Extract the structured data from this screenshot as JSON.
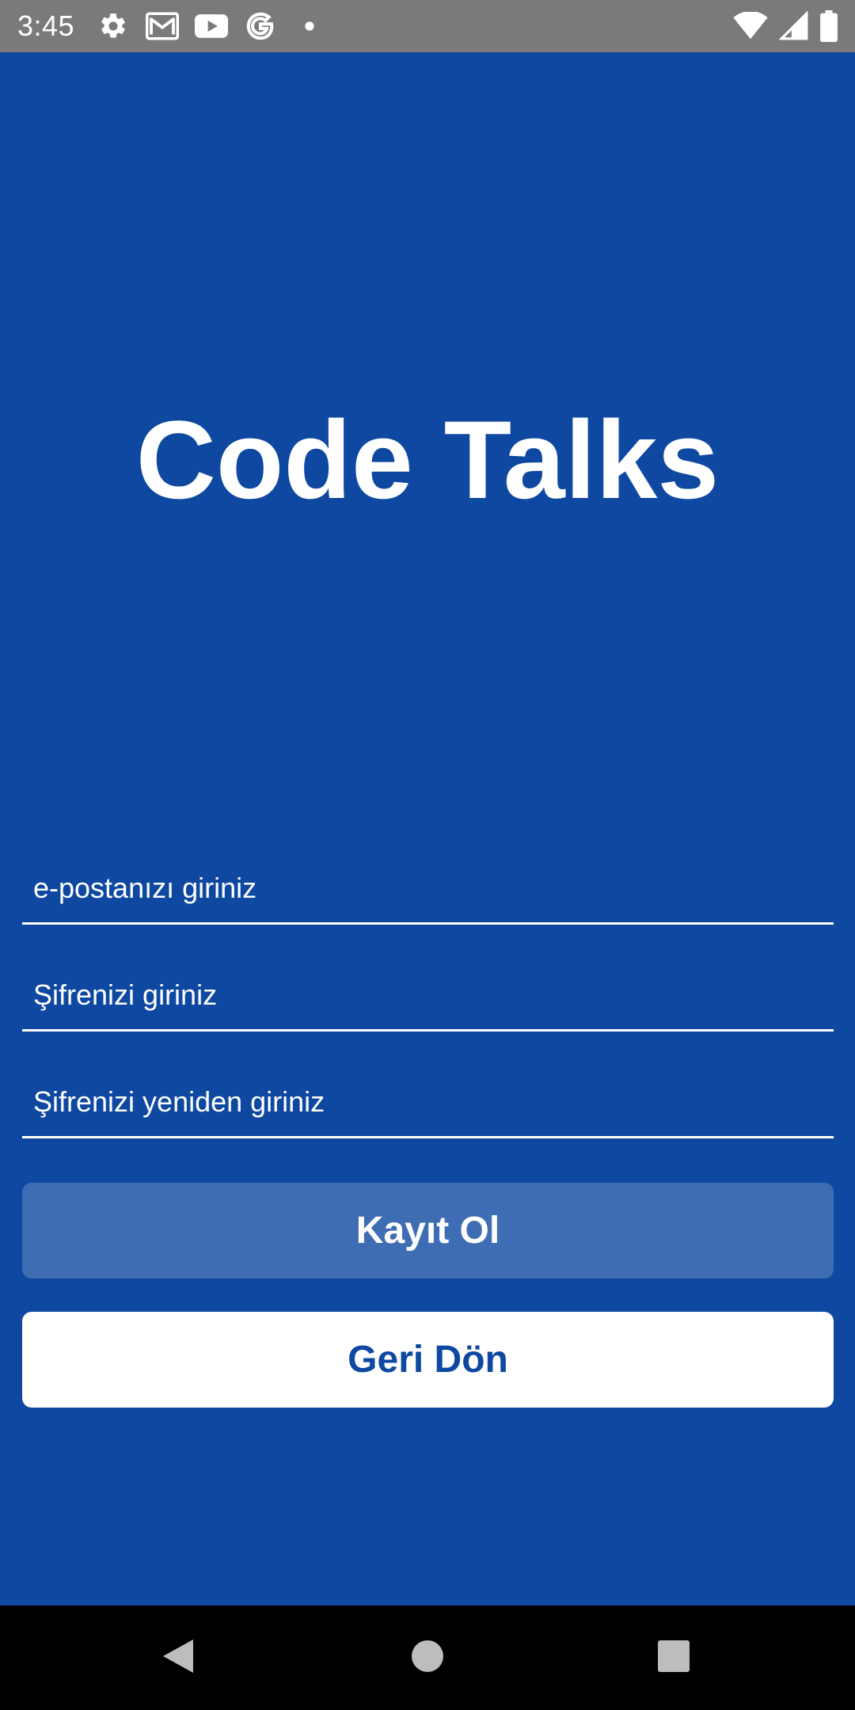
{
  "status_bar": {
    "time": "3:45",
    "left_icons": [
      "settings-icon",
      "gmail-icon",
      "youtube-icon",
      "google-icon",
      "notification-dot-icon"
    ],
    "right_icons": [
      "wifi-icon",
      "signal-icon",
      "battery-icon"
    ]
  },
  "app": {
    "title": "Code Talks"
  },
  "form": {
    "email_placeholder": "e-postanızı giriniz",
    "password_placeholder": "Şifrenizi giriniz",
    "password_repeat_placeholder": "Şifrenizi yeniden giriniz",
    "register_label": "Kayıt Ol",
    "back_label": "Geri Dön"
  },
  "colors": {
    "background": "#0e48a1",
    "register_button": "#3f6db4",
    "back_button": "#ffffff",
    "status_bar": "#7a7a7a",
    "nav_bar": "#000000"
  },
  "nav_bar": {
    "icons": [
      "back-icon",
      "home-icon",
      "recents-icon"
    ]
  }
}
